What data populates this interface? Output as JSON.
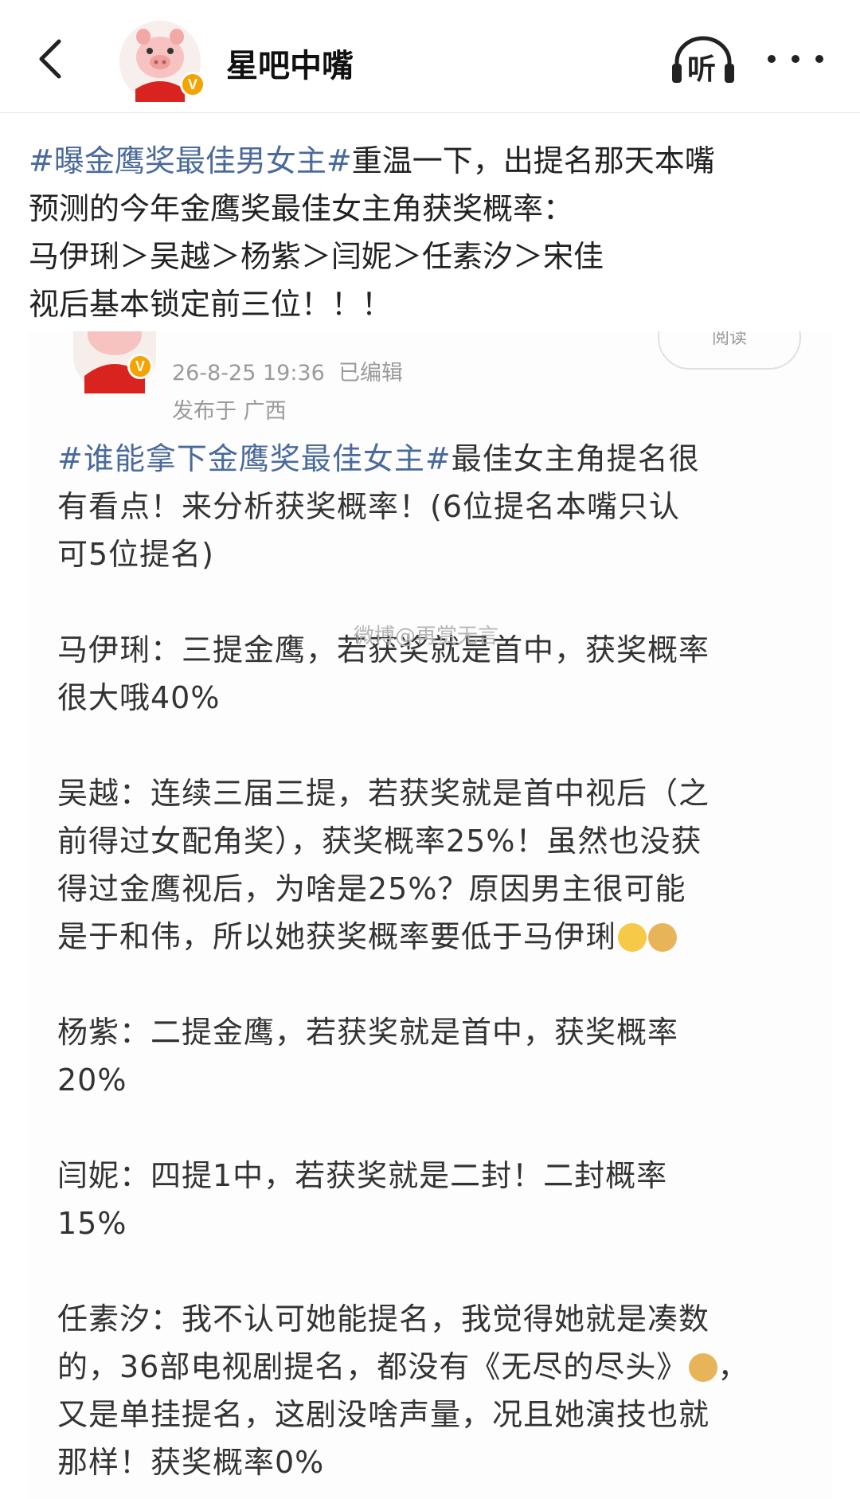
{
  "header": {
    "title": "星吧中嘴",
    "verified_badge": "V",
    "listen_label": "听"
  },
  "post": {
    "lines": [
      {
        "hashtag": "#曝金鹰奖最佳男女主#",
        "text": "重温一下，出提名那天本嘴"
      },
      {
        "hashtag": "",
        "text": "预测的今年金鹰奖最佳女主角获奖概率："
      },
      {
        "hashtag": "",
        "text": "马伊琍＞吴越＞杨紫＞闫妮＞任素汐＞宋佳"
      },
      {
        "hashtag": "",
        "text": "视后基本锁定前三位！！！"
      }
    ]
  },
  "embed": {
    "read_label": "阅读",
    "timestamp": "26-8-25 19:36",
    "edited": "已编辑",
    "location": "发布于 广西",
    "watermark": "微博@再赏无言",
    "intro_hashtag": "#谁能拿下金鹰奖最佳女主#",
    "intro_lines": [
      "最佳女主角提名很",
      "有看点！来分析获奖概率！(6位提名本嘴只认",
      "可5位提名)"
    ],
    "paragraphs": [
      [
        "马伊琍：三提金鹰，若获奖就是首中，获奖概率",
        "很大哦40%"
      ],
      [
        "吴越：连续三届三提，若获奖就是首中视后（之",
        "前得过女配角奖），获奖概率25%！虽然也没获",
        "得过金鹰视后，为啥是25%？原因男主很可能",
        "是于和伟，所以她获奖概率要低于马伊琍"
      ],
      [
        "杨紫：二提金鹰，若获奖就是首中，获奖概率",
        "20%"
      ],
      [
        "闫妮：四提1中，若获奖就是二封！二封概率",
        "15%"
      ],
      [
        "任素汐：我不认可她能提名，我觉得她就是凑数",
        "的，36部电视剧提名，都没有《无尽的尽头》",
        "又是单挂提名，这剧没啥声量，况且她演技也就",
        "那样！获奖概率0%"
      ]
    ],
    "emojis": [
      "laugh-cry-emoji",
      "doge-emoji"
    ]
  },
  "colors": {
    "hashtag": "#4a6a9a",
    "meta": "#9a9a9a",
    "badge": "#f5a300"
  }
}
